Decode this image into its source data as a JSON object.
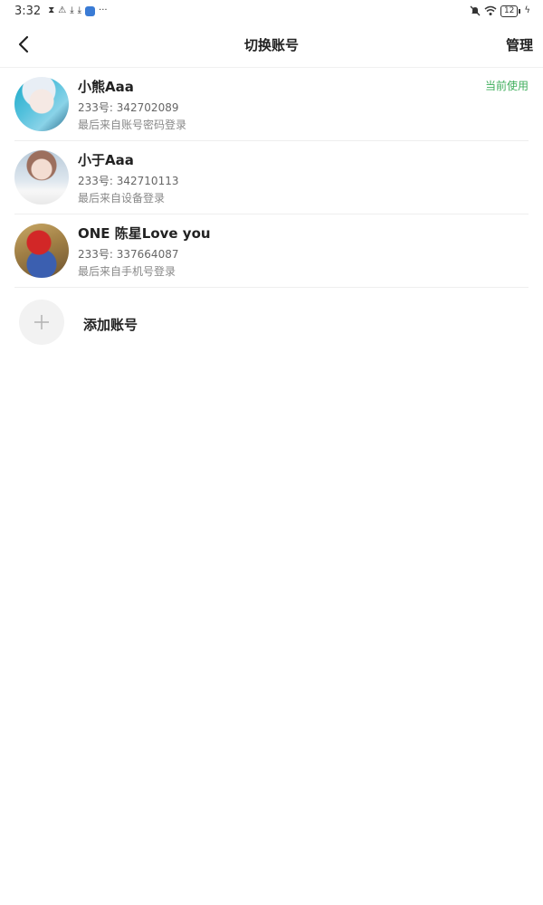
{
  "status_bar": {
    "time": "3:32",
    "battery": "12",
    "icons": [
      "hourglass-icon",
      "warning-icon",
      "download-icon",
      "download-icon",
      "cloud-icon",
      "more-dots-icon",
      "bell-off-icon",
      "wifi-icon",
      "battery-icon",
      "charging-icon"
    ]
  },
  "header": {
    "title": "切换账号",
    "manage_label": "管理"
  },
  "accounts": [
    {
      "name": "小熊Aaa",
      "id_text": "233号: 342702089",
      "login_text": "最后来自账号密码登录",
      "badge": "当前使用"
    },
    {
      "name": "小于Aaa",
      "id_text": "233号: 342710113",
      "login_text": "最后来自设备登录"
    },
    {
      "name": "ONE 陈星Love you",
      "id_text": "233号: 337664087",
      "login_text": "最后来自手机号登录"
    }
  ],
  "add_account": {
    "label": "添加账号"
  },
  "colors": {
    "accent_green": "#3fae5c",
    "text_primary": "#222222",
    "text_secondary": "#888888"
  }
}
